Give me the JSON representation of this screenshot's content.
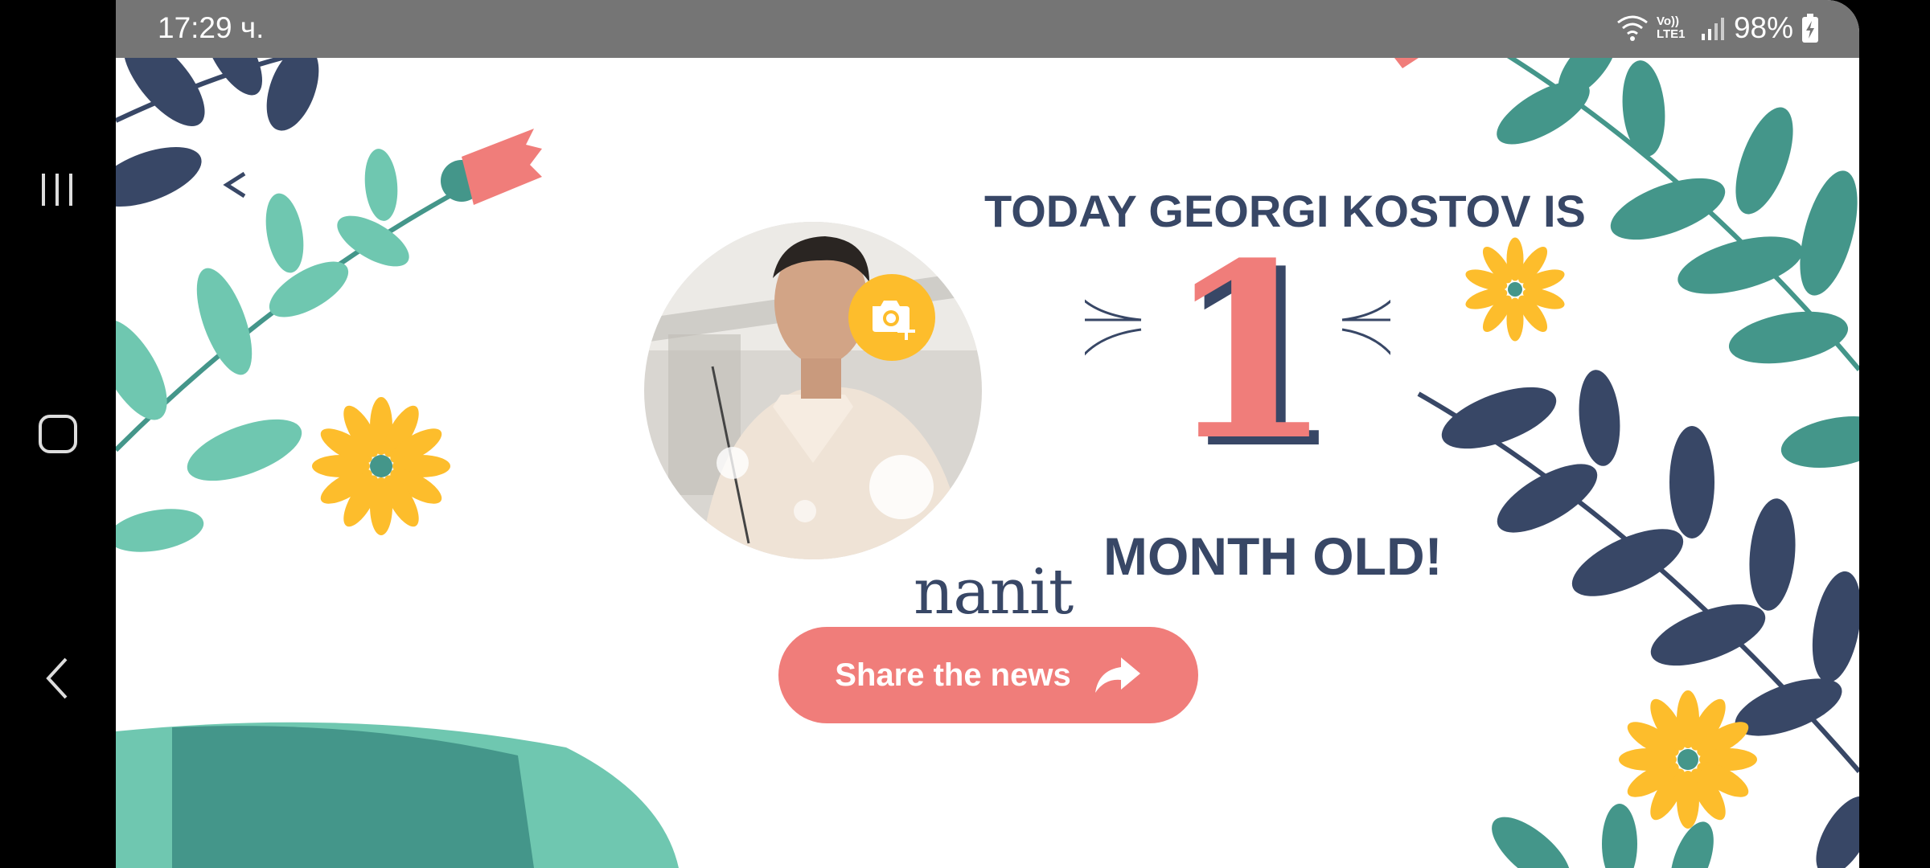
{
  "status_bar": {
    "time": "17:29 ч.",
    "network": "Vo)) LTE1",
    "battery": "98%"
  },
  "screen": {
    "heading_top": "TODAY GEORGI KOSTOV IS",
    "age_value": "1",
    "heading_bottom": "MONTH OLD!",
    "brand": "nanit",
    "share_label": "Share the news"
  },
  "colors": {
    "navy": "#384766",
    "coral": "#f07d7a",
    "yellow": "#fdbd2c",
    "teal": "#44968a",
    "mint": "#6fc7b0"
  },
  "icons": {
    "back": "back-arrow-icon",
    "camera": "add-photo-icon",
    "share": "share-arrow-icon"
  }
}
